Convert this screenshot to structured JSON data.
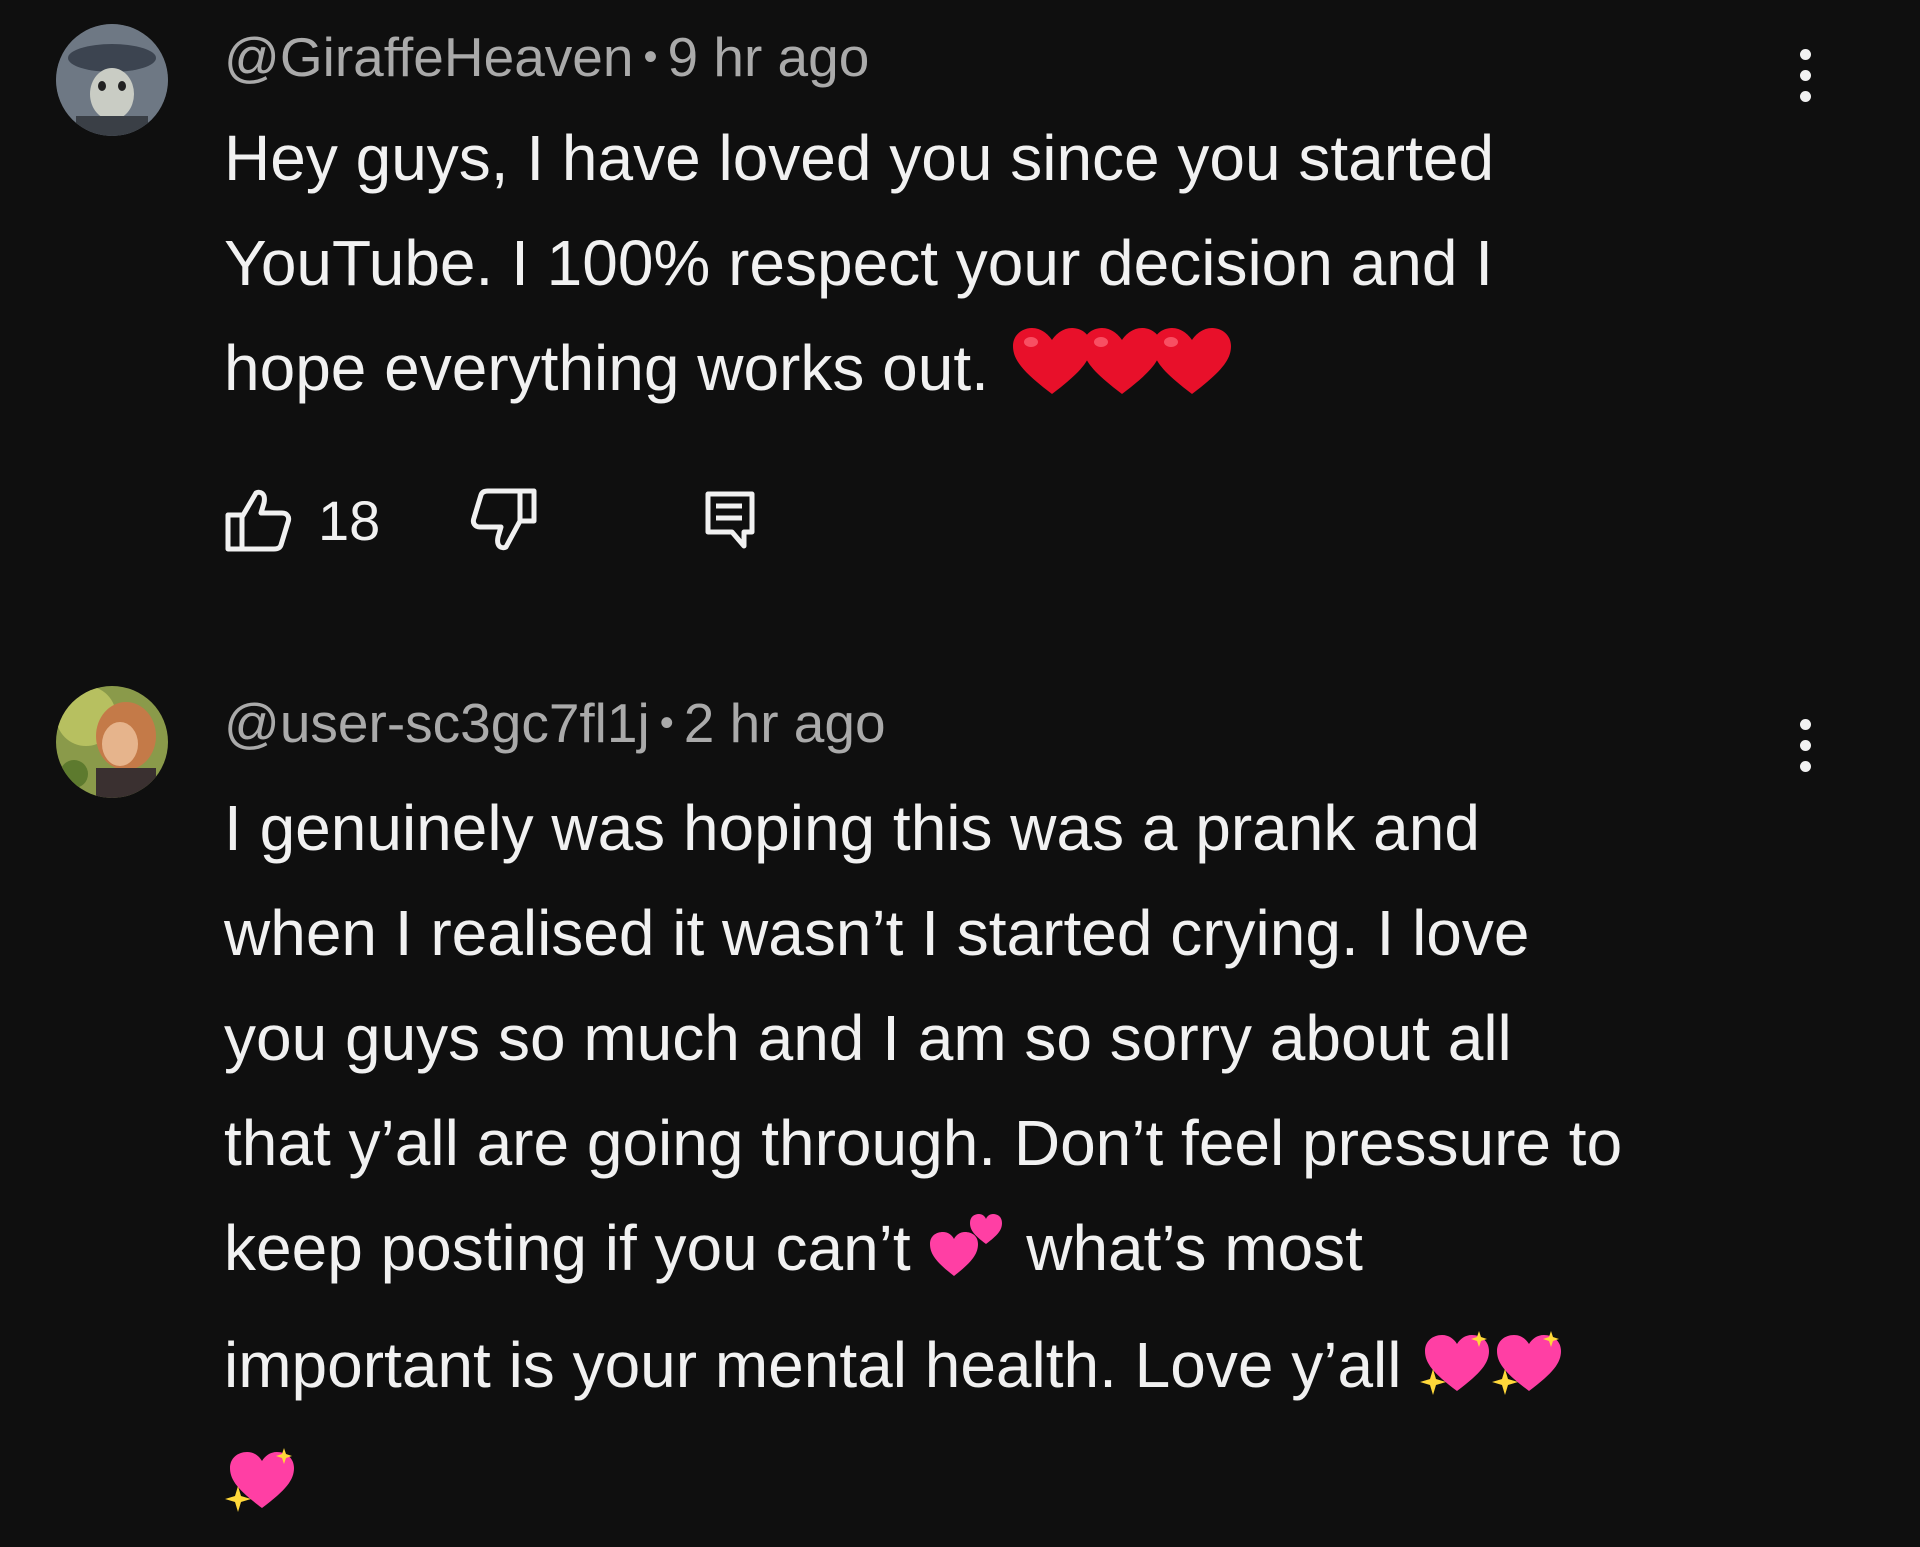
{
  "comments": [
    {
      "author": "@GiraffeHeaven",
      "time": "9 hr ago",
      "lines": [
        "Hey guys, I have loved you since you started",
        "YouTube. I 100% respect your decision and I",
        "hope everything works out."
      ],
      "emoji_after_last_line": [
        "red-heart",
        "red-heart",
        "red-heart"
      ],
      "like_count": "18"
    },
    {
      "author": "@user-sc3gc7fl1j",
      "time": "2 hr ago",
      "lines": [
        "I genuinely was hoping this was a prank and",
        "when I realised it wasn’t I started crying. I love",
        "you guys so much and I am so sorry about all",
        "that y’all are going through. Don’t feel pressure to",
        "keep posting if you can’t",
        "what’s most",
        "important is your mental health. Love y’all"
      ],
      "emojis": [
        "two-hearts",
        "sparkling-heart",
        "sparkling-heart",
        "sparkling-heart"
      ]
    }
  ],
  "separator": "•",
  "icons": [
    "kebab-menu-icon",
    "thumbs-up-icon",
    "thumbs-down-icon",
    "reply-icon"
  ],
  "colors": {
    "background": "#0f0f0f",
    "text_primary": "#f1f1f1",
    "text_secondary": "#aaaaaa",
    "heart_red": "#e8102a",
    "heart_pink": "#ff3fa4"
  }
}
